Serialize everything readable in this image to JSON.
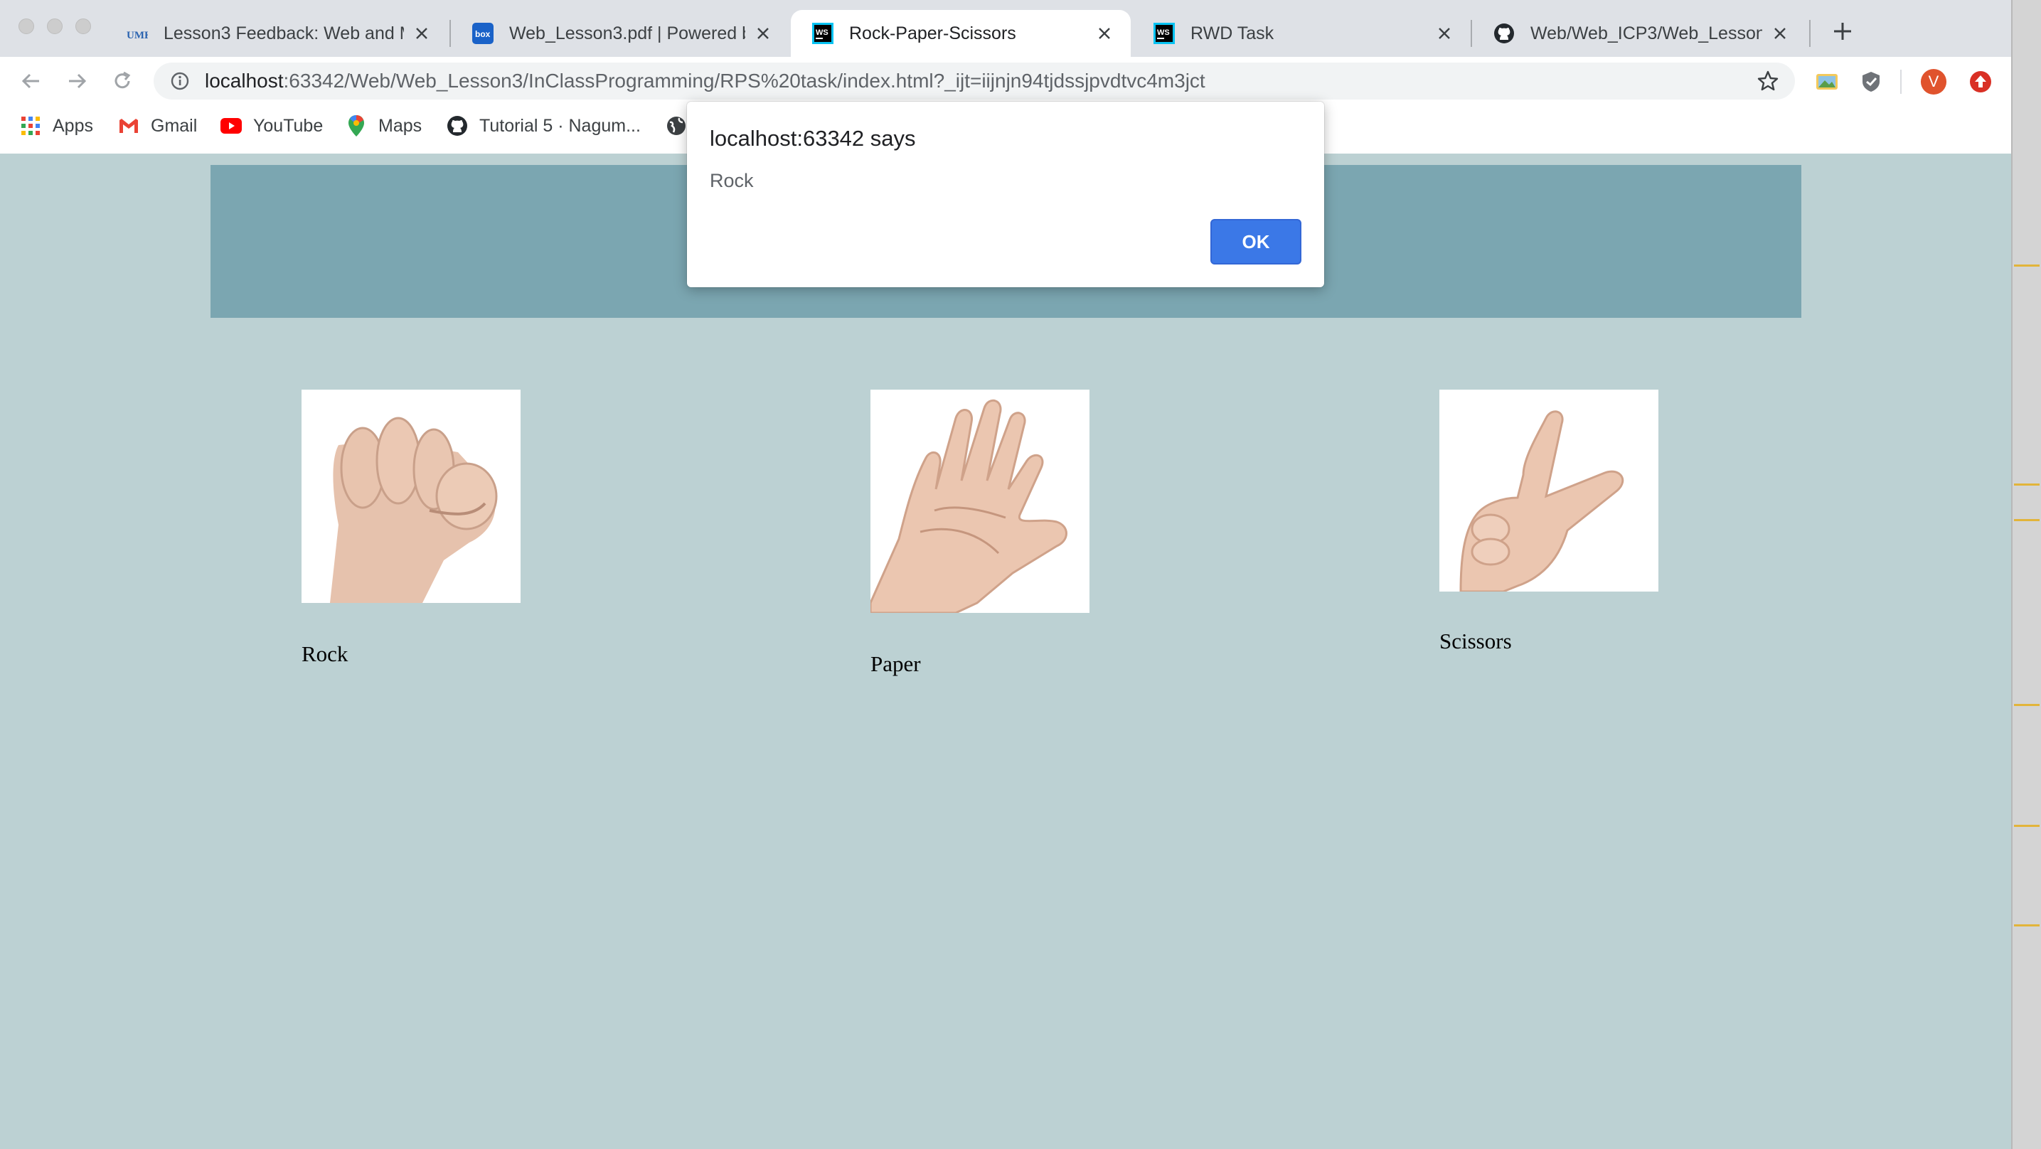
{
  "tabs": [
    {
      "title": "Lesson3 Feedback: Web and M",
      "favicon": "umkc-logo-icon",
      "active": false
    },
    {
      "title": "Web_Lesson3.pdf | Powered by",
      "favicon": "box-logo-icon",
      "active": false
    },
    {
      "title": "Rock-Paper-Scissors",
      "favicon": "webstorm-icon",
      "active": true
    },
    {
      "title": "RWD Task",
      "favicon": "webstorm-icon",
      "active": false
    },
    {
      "title": "Web/Web_ICP3/Web_Lesson3",
      "favicon": "github-icon",
      "active": false
    }
  ],
  "toolbar": {
    "url_host": "localhost",
    "url_rest": ":63342/Web/Web_Lesson3/InClassProgramming/RPS%20task/index.html?_ijt=iijnjn94tjdssjpvdtvc4m3jct",
    "profile_initial": "V"
  },
  "bookmarks": [
    {
      "label": "Apps",
      "icon": "apps-grid-icon"
    },
    {
      "label": "Gmail",
      "icon": "gmail-icon"
    },
    {
      "label": "YouTube",
      "icon": "youtube-icon"
    },
    {
      "label": "Maps",
      "icon": "maps-pin-icon"
    },
    {
      "label": "Tutorial 5 · Nagum...",
      "icon": "github-icon"
    },
    {
      "label": "",
      "icon": "globe-icon"
    }
  ],
  "dialog": {
    "title": "localhost:63342 says",
    "message": "Rock",
    "ok_label": "OK"
  },
  "choices": [
    {
      "label": "Rock",
      "image": "fist-hand-image"
    },
    {
      "label": "Paper",
      "image": "open-palm-hand-image"
    },
    {
      "label": "Scissors",
      "image": "two-finger-hand-image"
    }
  ],
  "colors": {
    "page_background": "#bcd1d3",
    "banner": "#7ba6b1",
    "ok_button": "#3b78e7",
    "profile_avatar": "#e0532d"
  }
}
